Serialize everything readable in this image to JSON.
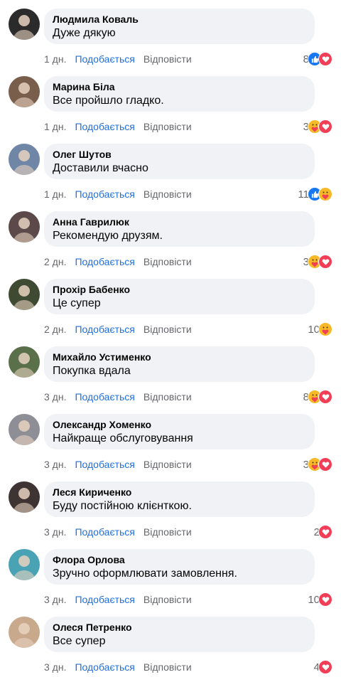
{
  "labels": {
    "like": "Подобається",
    "reply": "Відповісти"
  },
  "comments": [
    {
      "author": "Людмила Коваль",
      "text": "Дуже дякую",
      "time": "1 дн.",
      "count": "8",
      "reactions": [
        "like",
        "love"
      ],
      "avatar_color": "#2b2b2b"
    },
    {
      "author": "Марина Біла",
      "text": "Все пройшло гладко.",
      "time": "1 дн.",
      "count": "3",
      "reactions": [
        "care",
        "love"
      ],
      "avatar_color": "#7a5e4c"
    },
    {
      "author": "Олег Шутов",
      "text": "Доставили вчасно",
      "time": "1 дн.",
      "count": "11",
      "reactions": [
        "like",
        "care"
      ],
      "avatar_color": "#6f86a6"
    },
    {
      "author": "Анна Гаврилюк",
      "text": "Рекомендую друзям.",
      "time": "2 дн.",
      "count": "3",
      "reactions": [
        "care",
        "love"
      ],
      "avatar_color": "#5b4a49"
    },
    {
      "author": "Прохір Бабенко",
      "text": "Це супер",
      "time": "2 дн.",
      "count": "10",
      "reactions": [
        "care"
      ],
      "avatar_color": "#3e4a31"
    },
    {
      "author": "Михайло Устименко",
      "text": "Покупка вдала",
      "time": "3 дн.",
      "count": "8",
      "reactions": [
        "care",
        "love"
      ],
      "avatar_color": "#59704a"
    },
    {
      "author": "Олександр Хоменко",
      "text": "Найкраще обслуговування",
      "time": "3 дн.",
      "count": "3",
      "reactions": [
        "care",
        "love"
      ],
      "avatar_color": "#8e8f96"
    },
    {
      "author": "Леся Кириченко",
      "text": "Буду постійною клієнткою.",
      "time": "3 дн.",
      "count": "2",
      "reactions": [
        "love"
      ],
      "avatar_color": "#3d3433"
    },
    {
      "author": "Флора Орлова",
      "text": "Зручно оформлювати замовлення.",
      "time": "3 дн.",
      "count": "10",
      "reactions": [
        "love"
      ],
      "avatar_color": "#4aa3b5"
    },
    {
      "author": "Олеся Петренко",
      "text": "Все супер",
      "time": "3 дн.",
      "count": "4",
      "reactions": [
        "love"
      ],
      "avatar_color": "#c9a98c"
    }
  ]
}
